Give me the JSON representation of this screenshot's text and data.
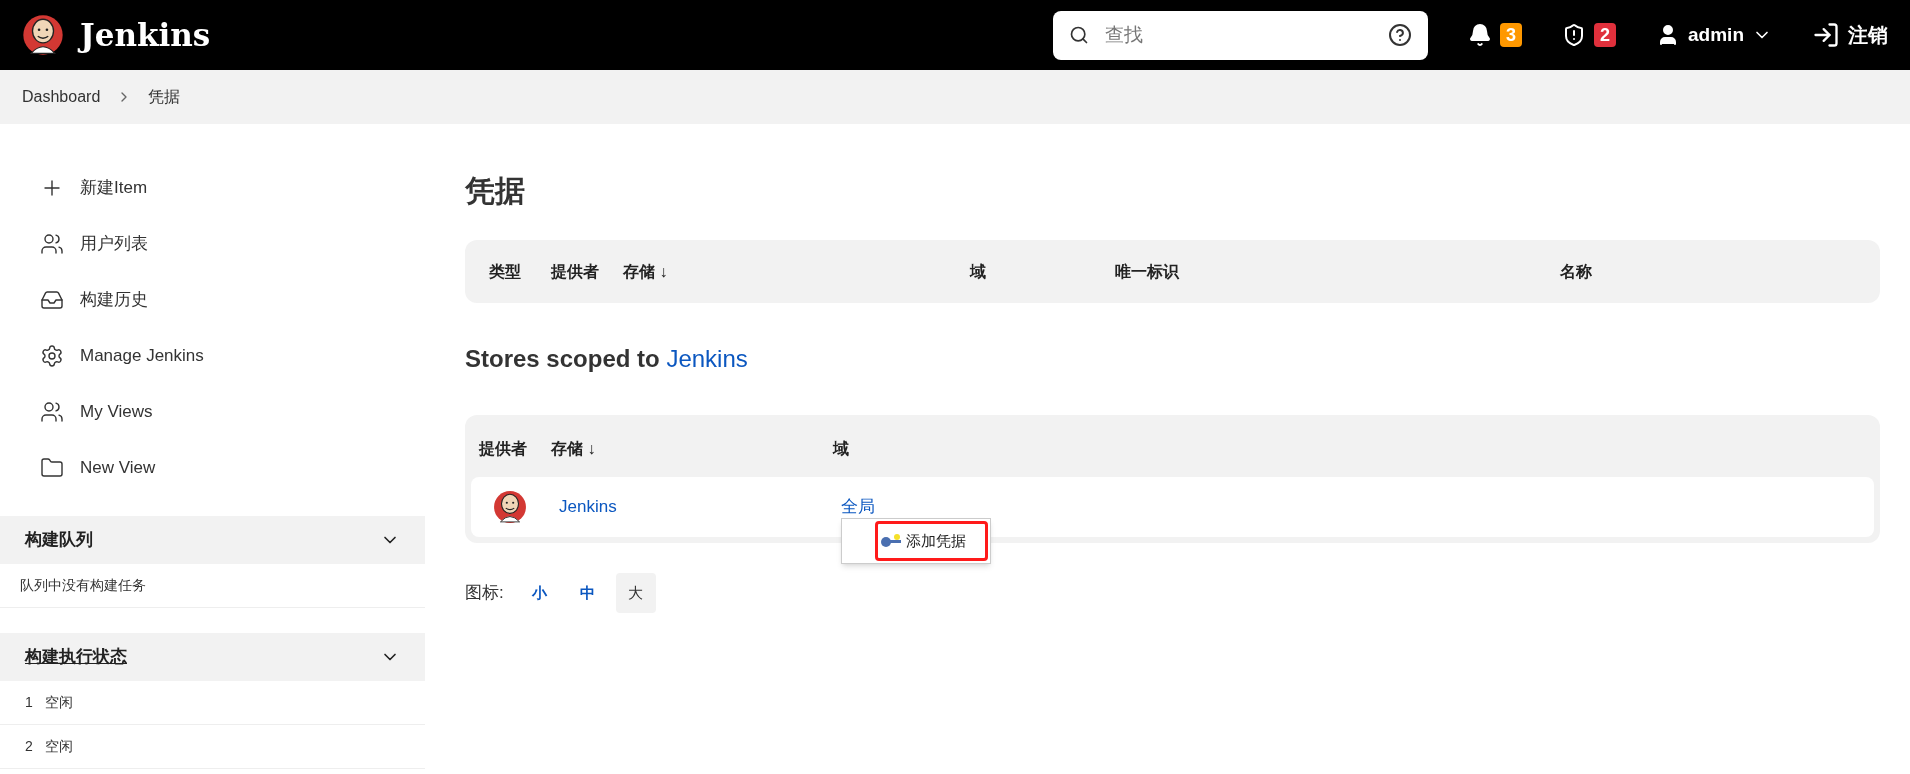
{
  "header": {
    "brand": "Jenkins",
    "search": {
      "placeholder": "查找"
    },
    "notifications": {
      "count": "3"
    },
    "security": {
      "count": "2"
    },
    "user": "admin",
    "logout": "注销"
  },
  "breadcrumbs": [
    "Dashboard",
    "凭据"
  ],
  "sidebar": {
    "items": [
      {
        "kind": "add",
        "label": "新建Item"
      },
      {
        "kind": "people",
        "label": "用户列表"
      },
      {
        "kind": "history",
        "label": "构建历史"
      },
      {
        "kind": "gear",
        "label": "Manage Jenkins"
      },
      {
        "kind": "people",
        "label": "My Views"
      },
      {
        "kind": "folder",
        "label": "New View"
      }
    ],
    "queue": {
      "title": "构建队列",
      "expanded": true,
      "empty_text": "队列中没有构建任务"
    },
    "executors": {
      "title": "构建执行状态",
      "expanded": true,
      "rows": [
        {
          "number": "1",
          "status": "空闲"
        },
        {
          "number": "2",
          "status": "空闲"
        }
      ]
    }
  },
  "main": {
    "title": "凭据",
    "credentials_table": {
      "columns": [
        "类型",
        "提供者",
        "存储 ↓",
        "域",
        "唯一标识",
        "名称"
      ]
    },
    "stores_heading": {
      "text": "Stores scoped to ",
      "link": "Jenkins"
    },
    "stores_table": {
      "columns": [
        "提供者",
        "存储 ↓",
        "域"
      ],
      "rows": [
        {
          "store": "Jenkins",
          "domain": "全局"
        }
      ]
    },
    "context_menu": {
      "items": [
        {
          "label": "添加凭据",
          "highlighted": true
        }
      ]
    },
    "icon_size": {
      "label": "图标:",
      "options": [
        {
          "label": "小",
          "selected": false
        },
        {
          "label": "中",
          "selected": false
        },
        {
          "label": "大",
          "selected": true
        }
      ]
    }
  }
}
